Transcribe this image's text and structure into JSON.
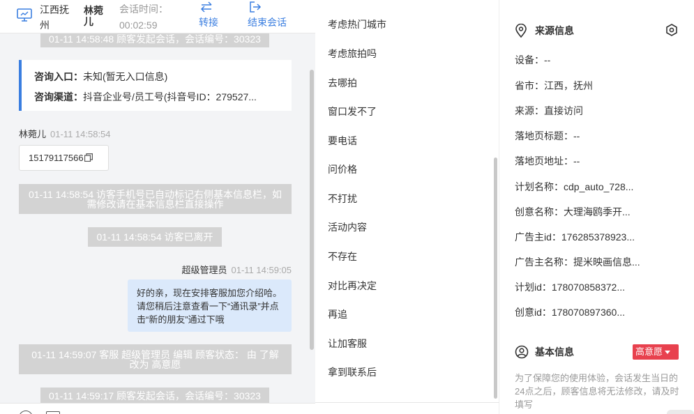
{
  "header": {
    "city": "江西抚州",
    "visitor_name": "林菀儿",
    "session_time_label": "会话时间：",
    "session_time": "00:02:59",
    "transfer_label": "转接",
    "end_label": "结束会话"
  },
  "chat": {
    "sys_msg_1": "01-11 14:58:48 顾客发起会话，会话编号：30323",
    "entry_label": "咨询入口：",
    "entry_value": "未知(暂无入口信息)",
    "channel_label": "咨询渠道：",
    "channel_value": "抖音企业号/员工号(抖音号ID：279527...",
    "visitor_name": "林菀儿",
    "visitor_time": "01-11 14:58:54",
    "phone": "15179117566",
    "sys_msg_2": "01-11 14:58:54 访客手机号已自动标记右侧基本信息栏，如需修改请在基本信息栏直接操作",
    "sys_msg_3": "01-11 14:58:54 访客已离开",
    "agent_name": "超级管理员",
    "agent_time": "01-11 14:59:05",
    "agent_message": "好的亲，现在安排客服加您介绍哈。请您稍后注意查看一下“通讯录”并点击“新的朋友”通过下哦",
    "sys_msg_4": "01-11 14:59:07 客服 超级管理员 编辑 顾客状态： 由 了解 改为 高意愿",
    "sys_msg_5": "01-11 14:59:17 顾客发起会话，会话编号：30323"
  },
  "quick_replies": [
    "考虑热门城市",
    "考虑旅拍吗",
    "去哪拍",
    "窗口发不了",
    "要电话",
    "问价格",
    "不打扰",
    "活动内容",
    "不存在",
    "对比再决定",
    "再追",
    "让加客服",
    "拿到联系后"
  ],
  "source_info": {
    "title": "来源信息",
    "rows": [
      "设备：--",
      "省市：江西，抚州",
      "来源：直接访问",
      "落地页标题：--",
      "落地页地址：--",
      "计划名称：cdp_auto_728...",
      "创意名称：大理海鸥季开...",
      "广告主id：176285378923...",
      "广告主名称：提米映画信息...",
      "计划id：178070858372...",
      "创意id：178070897360..."
    ]
  },
  "basic_info": {
    "title": "基本信息",
    "intent": "高意愿",
    "note": "为了保障您的使用体验，会话发生当日的24点之后，顾客信息将无法修改，请及时填写"
  },
  "colors": {
    "accent": "#3a7ee0",
    "badge": "#e8414e",
    "agent_bubble": "#dbe9fb",
    "system_msg": "#d3d3d3"
  }
}
